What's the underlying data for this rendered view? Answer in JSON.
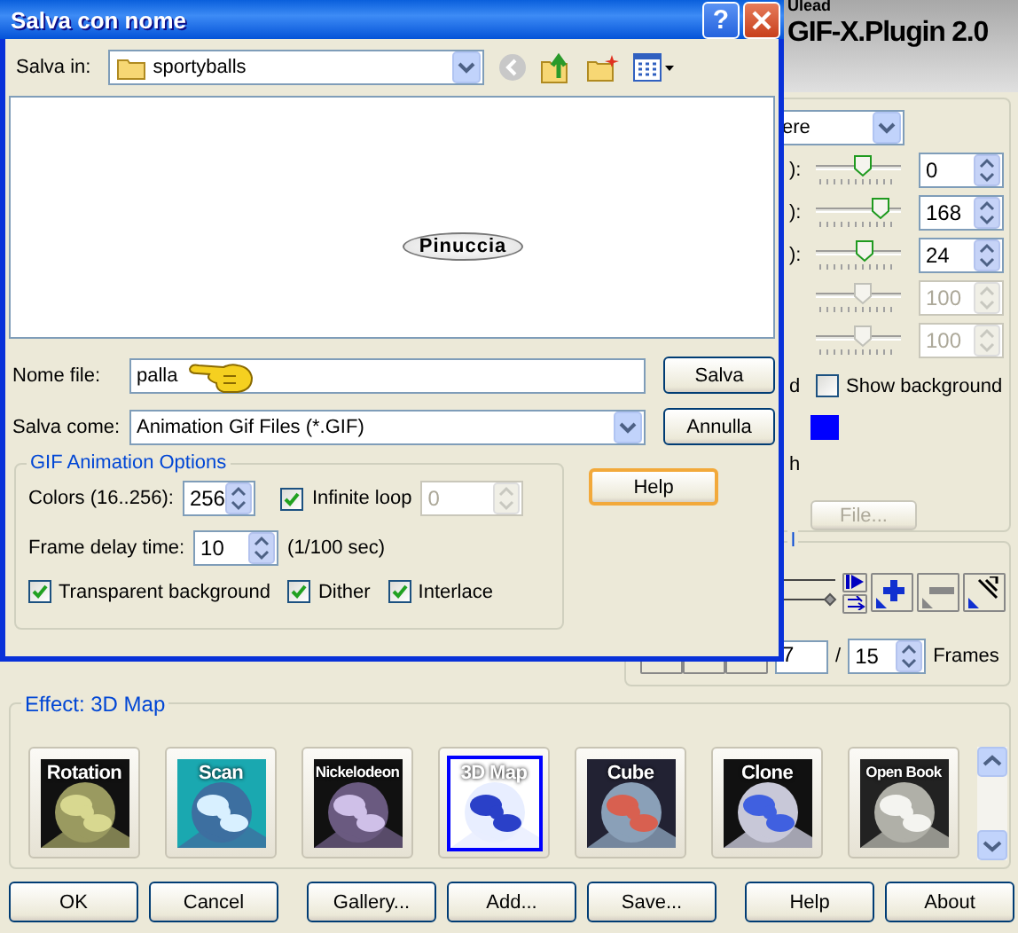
{
  "app": {
    "logo": {
      "vendor": "Ulead",
      "product": "GIF-X.Plugin 2.0"
    },
    "settings_panel": {
      "dropdown": "ere",
      "sliders": [
        {
          "label": "):",
          "level": 0.54,
          "value": "0",
          "disabled": false
        },
        {
          "label": "):",
          "level": 0.74,
          "value": "168",
          "disabled": false
        },
        {
          "label": "):",
          "level": 0.56,
          "value": "24",
          "disabled": false
        },
        {
          "level": 0.54,
          "value": "100",
          "disabled": true
        },
        {
          "level": 0.54,
          "value": "100",
          "disabled": true
        }
      ],
      "show_background": {
        "fragment": "d",
        "label": "Show background",
        "checked": false
      },
      "swatch": {
        "color": "#0000ff"
      },
      "fragment": "h",
      "file_button": {
        "label": "File...",
        "disabled": true
      }
    },
    "frames": {
      "title": "l",
      "current": "7",
      "separator": "/",
      "total": "15",
      "unit": "Frames"
    },
    "effects": {
      "title": "Effect: 3D Map",
      "items": [
        {
          "label": "Rotation",
          "selected": false
        },
        {
          "label": "Scan",
          "selected": false
        },
        {
          "label": "Nickelodeon",
          "selected": false
        },
        {
          "label": "3D Map",
          "selected": true
        },
        {
          "label": "Cube",
          "selected": false
        },
        {
          "label": "Clone",
          "selected": false
        },
        {
          "label": "Open Book",
          "selected": false
        }
      ]
    },
    "button_groups": [
      [
        "OK",
        "Cancel"
      ],
      [
        "Gallery...",
        "Add...",
        "Save..."
      ],
      [
        "Help",
        "About"
      ]
    ]
  },
  "dialog": {
    "title": "Salva con nome",
    "title_buttons": [
      "?"
    ],
    "save_in": {
      "label": "Salva in:",
      "value": "sportyballs"
    },
    "preview": {
      "text": "Pinuccia"
    },
    "file_name": {
      "label": "Nome file:",
      "value": "palla"
    },
    "save_as": {
      "label": "Salva come:",
      "value": "Animation Gif Files (*.GIF)"
    },
    "save_button": "Salva",
    "cancel_button": "Annulla",
    "help_button": {
      "label": "Help",
      "focused": true
    },
    "options": {
      "title": "GIF Animation Options",
      "colors": {
        "label": "Colors (16..256):",
        "value": "256"
      },
      "infinite_loop": {
        "label": "Infinite loop",
        "checked": true,
        "count": "0",
        "count_disabled": true
      },
      "frame_delay": {
        "label": "Frame delay time:",
        "value": "10",
        "unit": "(1/100 sec)"
      },
      "checkboxes": [
        {
          "label": "Transparent background",
          "checked": true
        },
        {
          "label": "Dither",
          "checked": true
        },
        {
          "label": "Interlace",
          "checked": true
        }
      ]
    }
  }
}
